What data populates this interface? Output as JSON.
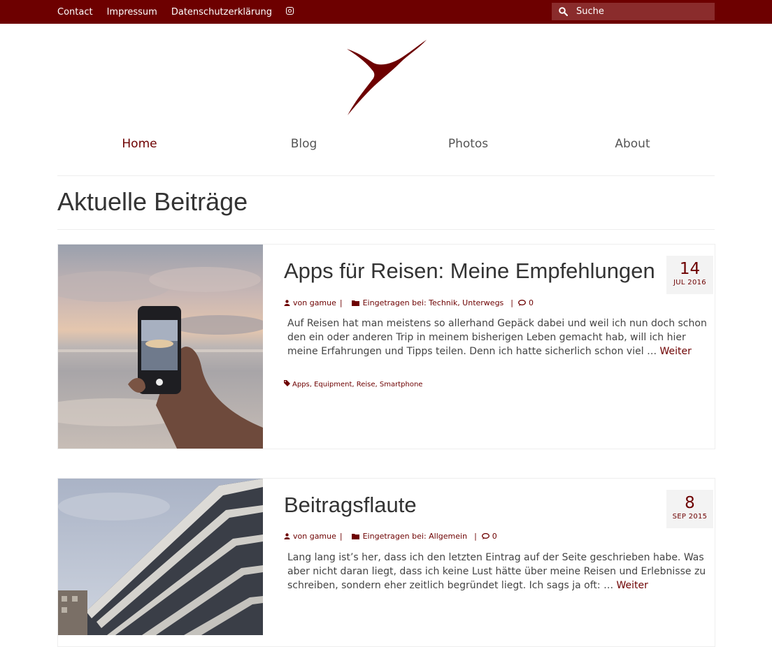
{
  "topbar": {
    "links": [
      "Contact",
      "Impressum",
      "Datenschutzerklärung"
    ],
    "search_placeholder": "Suche",
    "color": "#6d0000"
  },
  "nav": {
    "items": [
      "Home",
      "Blog",
      "Photos",
      "About"
    ],
    "active": "Home"
  },
  "page": {
    "title": "Aktuelle Beiträge"
  },
  "posts": [
    {
      "title": "Apps für Reisen: Meine Empfehlungen",
      "day": "14",
      "month": "JUL 2016",
      "author": "von gamue",
      "category_label": "Eingetragen bei:",
      "categories": "Technik, Unterwegs",
      "comments": "0",
      "excerpt": "Auf Reisen hat man meistens so allerhand Gepäck dabei und weil ich nun doch schon den ein oder anderen Trip in meinem bisherigen Leben gemacht hab, will ich hier meine Erfahrungen und Tipps teilen. Denn ich hatte sicherlich schon viel …",
      "more": "Weiter",
      "tags": "Apps, Equipment, Reise, Smartphone"
    },
    {
      "title": "Beitragsflaute",
      "day": "8",
      "month": "SEP 2015",
      "author": "von gamue",
      "category_label": "Eingetragen bei:",
      "categories": "Allgemein",
      "comments": "0",
      "excerpt": "Lang lang ist’s her, dass ich den letzten Eintrag auf der Seite geschrieben habe. Was aber nicht daran liegt, dass ich keine Lust hätte über meine Reisen und Erlebnisse zu schreiben, sondern eher zeitlich begründet liegt. Ich sags ja oft: …",
      "more": "Weiter"
    }
  ]
}
